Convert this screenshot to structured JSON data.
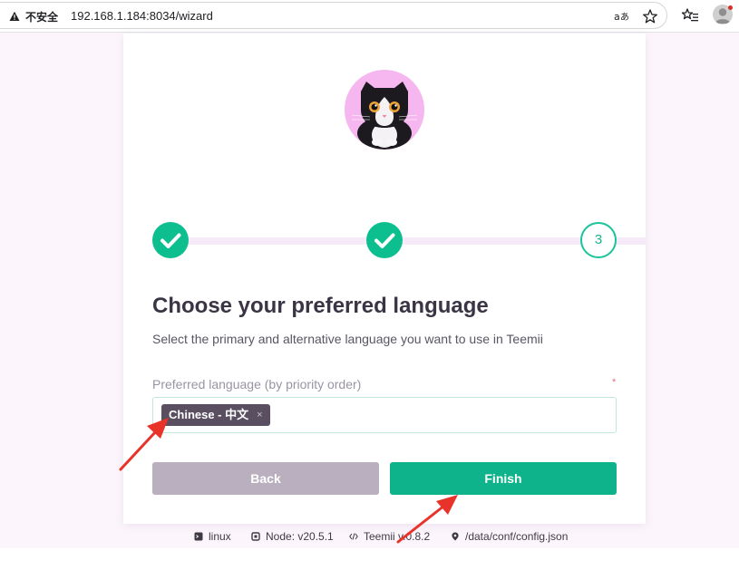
{
  "browser": {
    "security_label": "不安全",
    "url": "192.168.1.184:8034/wizard",
    "icons": [
      "warning-icon",
      "read-aloud-icon",
      "favorite-star-icon",
      "favorites-list-icon",
      "profile-avatar-icon"
    ]
  },
  "wizard": {
    "steps": [
      {
        "state": "done",
        "icon": "check-icon"
      },
      {
        "state": "done",
        "icon": "check-icon"
      },
      {
        "state": "current",
        "label": "3"
      }
    ],
    "title": "Choose your preferred language",
    "subtitle": "Select the primary and alternative language you want to use in Teemii",
    "field": {
      "label": "Preferred language (by priority order)",
      "required_mark": "*",
      "selected": [
        {
          "label": "Chinese - 中文",
          "remove": "×"
        }
      ]
    },
    "buttons": {
      "back": "Back",
      "finish": "Finish"
    }
  },
  "footer": {
    "os": "linux",
    "node": "Node: v20.5.1",
    "version": "Teemii v.0.8.2",
    "config": "/data/conf/config.json"
  },
  "colors": {
    "accent": "#0eb38b",
    "step_done": "#0dbf8f",
    "back_button": "#b9afbe",
    "chip": "#5a4e61",
    "annotation_arrow": "#e8322a",
    "logo_ring": "#f6b7f0"
  }
}
